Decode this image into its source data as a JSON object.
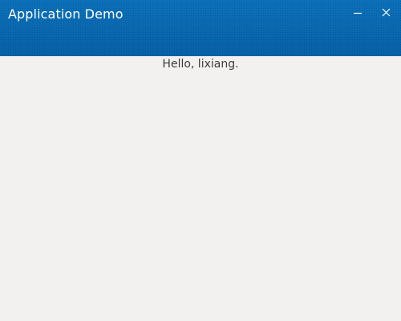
{
  "window": {
    "title": "Application Demo",
    "controls": {
      "minimize_icon": "minimize-icon",
      "close_icon": "close-icon"
    },
    "colors": {
      "titlebar": "#0a66b0",
      "title_text": "#ffffff",
      "background": "#f2f1f0"
    }
  },
  "content": {
    "greeting": "Hello, lixiang.",
    "colors": {
      "text": "#3c3c3c"
    }
  }
}
